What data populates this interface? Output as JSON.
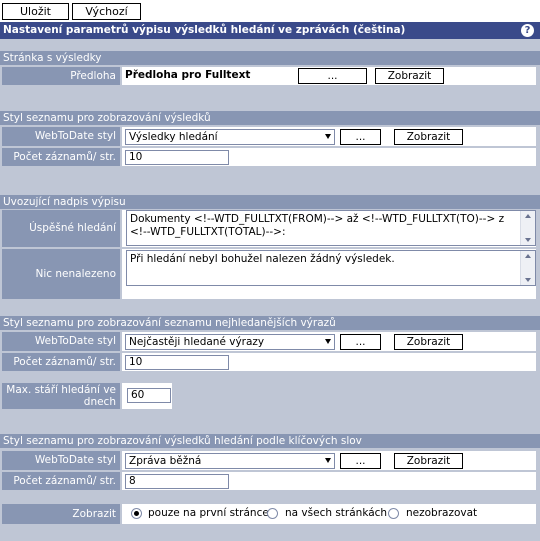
{
  "toolbar": {
    "save": "Uložit",
    "defaults": "Výchozí"
  },
  "title": "Nastavení parametrů výpisu výsledků hledání ve zprávách (čeština)",
  "help_icon": "?",
  "sec1": {
    "header": "Stránka s výsledky",
    "label": "Předloha",
    "value": "Předloha pro Fulltext",
    "browse": "...",
    "show": "Zobrazit"
  },
  "sec2": {
    "header": "Styl seznamu pro zobrazování výsledků",
    "style_label": "WebToDate styl",
    "style_value": "Výsledky hledání",
    "browse": "...",
    "show": "Zobrazit",
    "count_label": "Počet záznamů/ str.",
    "count_value": "10"
  },
  "sec3": {
    "header": "Uvozující nadpis výpisu",
    "success_label": "Úspěšné hledání",
    "success_text": "Dokumenty <!--WTD_FULLTXT(FROM)--> až <!--WTD_FULLTXT(TO)--> z <!--WTD_FULLTXT(TOTAL)-->:",
    "none_label": "Nic nenalezeno",
    "none_text": "Při hledání nebyl bohužel nalezen žádný výsledek."
  },
  "sec4": {
    "header": "Styl seznamu pro zobrazování seznamu nejhledanějších výrazů",
    "style_label": "WebToDate styl",
    "style_value": "Nejčastěji hledané výrazy",
    "browse": "...",
    "show": "Zobrazit",
    "count_label": "Počet záznamů/ str.",
    "count_value": "10",
    "age_label": "Max. stáří hledání ve dnech",
    "age_value": "60"
  },
  "sec5": {
    "header": "Styl seznamu pro zobrazování výsledků hledání podle klíčových slov",
    "style_label": "WebToDate styl",
    "style_value": "Zpráva běžná",
    "browse": "...",
    "show": "Zobrazit",
    "count_label": "Počet záznamů/ str.",
    "count_value": "8"
  },
  "display": {
    "label": "Zobrazit",
    "options": [
      "pouze na první stránce",
      "na všech stránkách",
      "nezobrazovat"
    ],
    "selected": 0
  }
}
